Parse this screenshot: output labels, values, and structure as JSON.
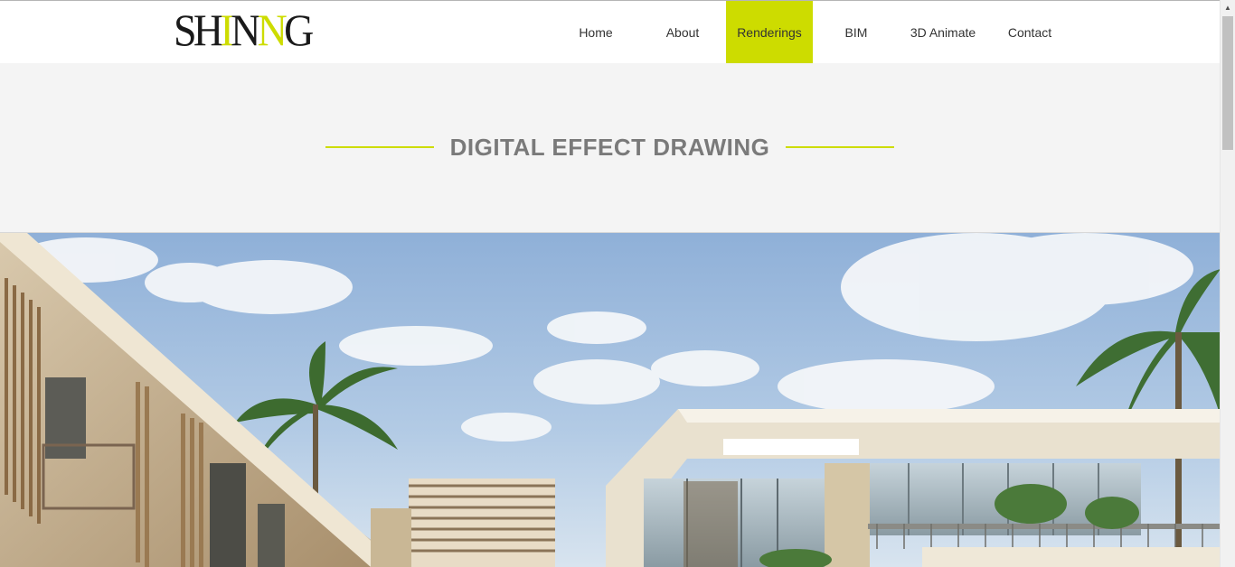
{
  "logo": {
    "part1": "SH",
    "part2": "I",
    "part3": "N",
    "part4": "N",
    "part5": "G",
    "accent_color": "#cddc00"
  },
  "nav": {
    "items": [
      {
        "label": "Home",
        "active": false
      },
      {
        "label": "About",
        "active": false
      },
      {
        "label": "Renderings",
        "active": true
      },
      {
        "label": "BIM",
        "active": false
      },
      {
        "label": "3D Animate",
        "active": false
      },
      {
        "label": "Contact",
        "active": false
      }
    ],
    "active_color": "#cddc00"
  },
  "section": {
    "title": "DIGITAL EFFECT DRAWING"
  },
  "hero": {
    "icon": "architecture-rendering-image"
  },
  "scrollbar": {
    "up_arrow": "▲"
  }
}
